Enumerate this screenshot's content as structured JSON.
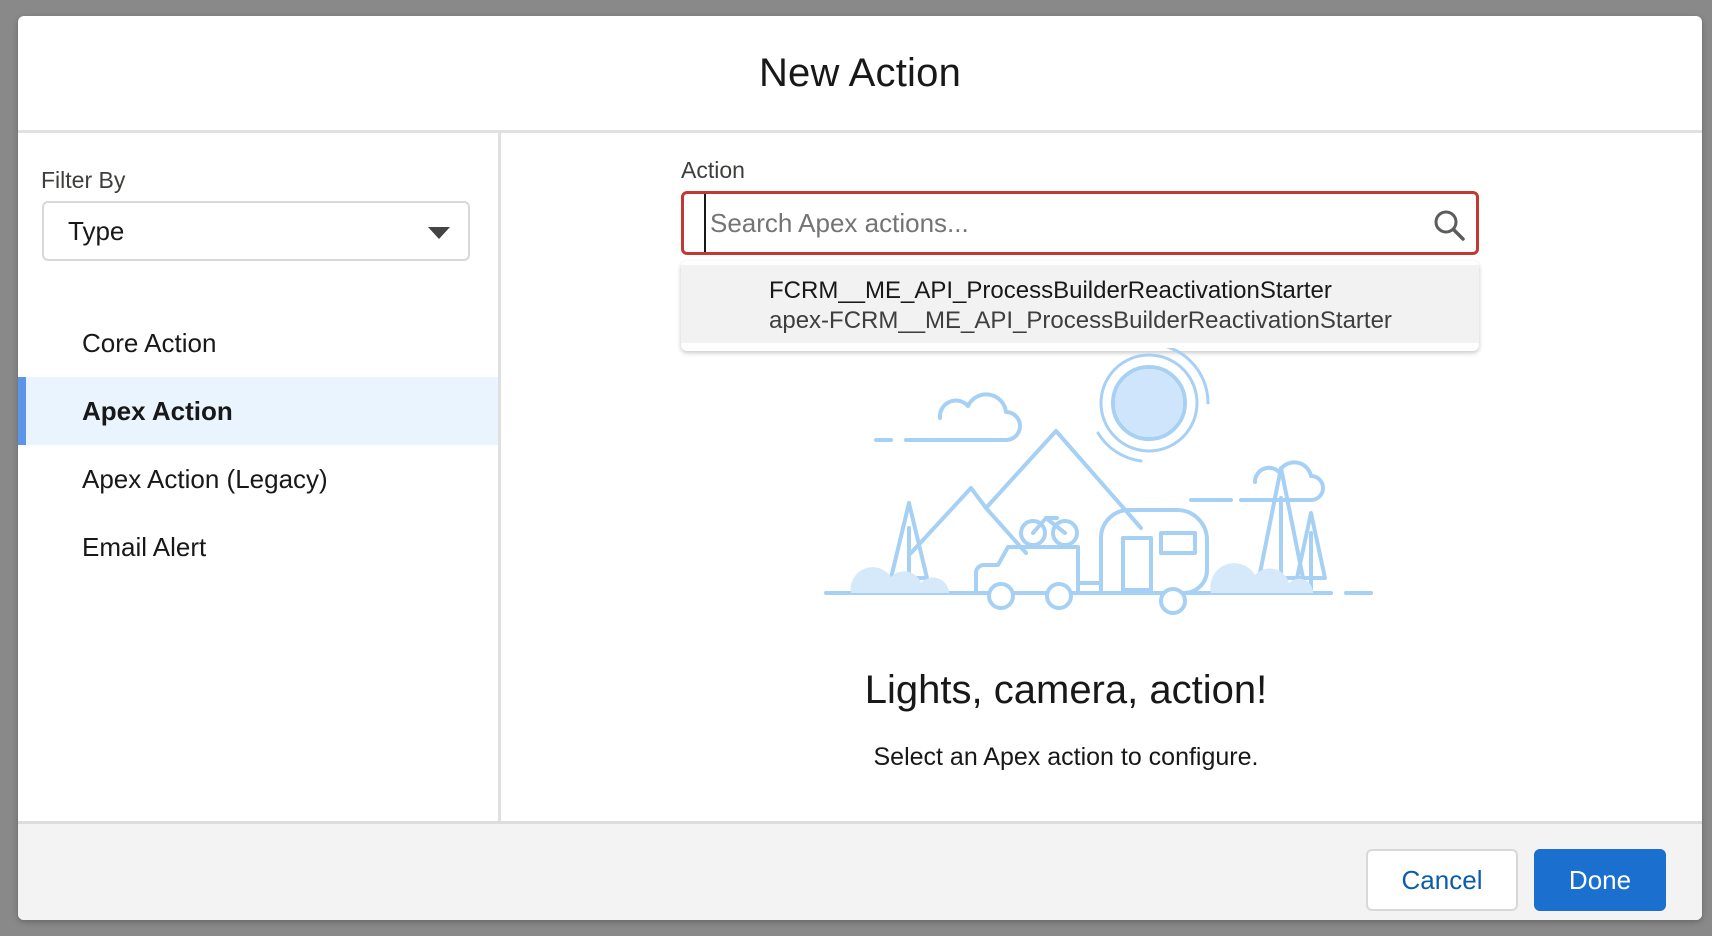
{
  "modal": {
    "title": "New Action"
  },
  "sidebar": {
    "filter_label": "Filter By",
    "filter_value": "Type",
    "items": [
      {
        "label": "Core Action",
        "active": false
      },
      {
        "label": "Apex Action",
        "active": true
      },
      {
        "label": "Apex Action (Legacy)",
        "active": false
      },
      {
        "label": "Email Alert",
        "active": false
      }
    ]
  },
  "main": {
    "field_label": "Action",
    "search_placeholder": "Search Apex actions...",
    "search_value": "",
    "results": [
      {
        "title": "FCRM__ME_API_ProcessBuilderReactivationStarter",
        "subtitle": "apex-FCRM__ME_API_ProcessBuilderReactivationStarter"
      }
    ],
    "empty_state": {
      "title": "Lights, camera, action!",
      "body": "Select an Apex action to configure."
    }
  },
  "footer": {
    "cancel_label": "Cancel",
    "done_label": "Done"
  },
  "colors": {
    "accent": "#1b6fcf",
    "error_border": "#c23934",
    "active_nav_bg": "#eaf4fe",
    "active_nav_bar": "#5c94e8",
    "illustration": "#a7d0f5"
  },
  "icons": {
    "search": "magnifying-glass",
    "filter_caret": "triangle-down",
    "illustration": "camping-scene-car-trailer"
  }
}
